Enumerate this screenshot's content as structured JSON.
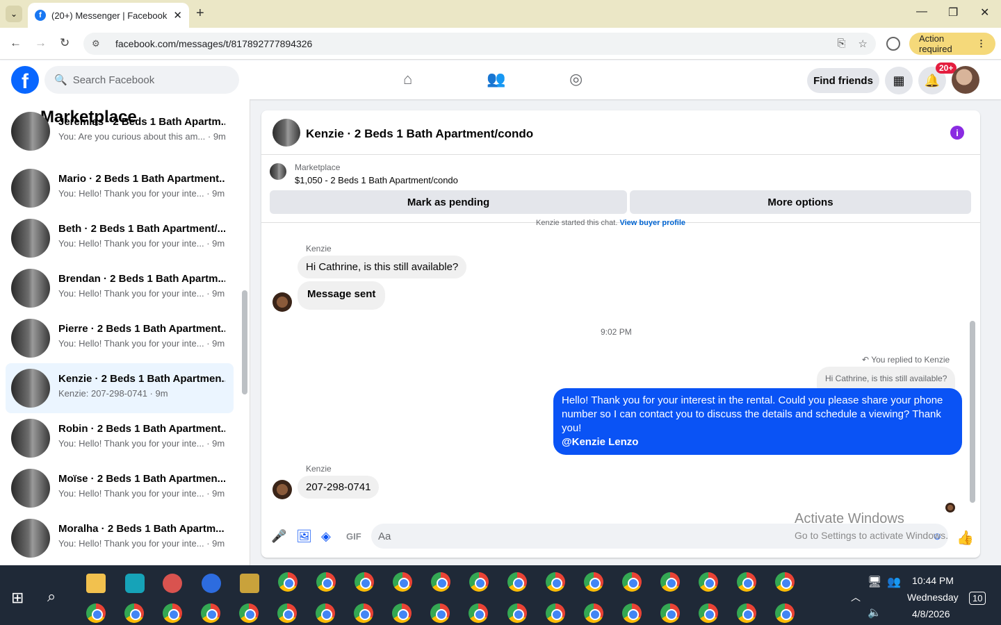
{
  "browser": {
    "tab_title": "(20+) Messenger | Facebook",
    "url": "facebook.com/messages/t/817892777894326",
    "action_required": "Action required",
    "new_tab": "+",
    "close_tab": "✕",
    "minimize": "—",
    "maximize": "❐",
    "close_window": "✕"
  },
  "fb": {
    "search_placeholder": "Search Facebook",
    "find_friends": "Find friends",
    "notif_count": "20+"
  },
  "sidebar": {
    "title": "Marketplace",
    "conversations": [
      {
        "name": "Jeremias · 2 Beds 1 Bath Apartm...",
        "snippet": "You: Are you curious about this am...",
        "time": "9m"
      },
      {
        "name": "Mario · 2 Beds 1 Bath Apartment...",
        "snippet": "You: Hello! Thank you for your inte...",
        "time": "9m"
      },
      {
        "name": "Beth · 2 Beds 1 Bath Apartment/...",
        "snippet": "You: Hello! Thank you for your inte...",
        "time": "9m"
      },
      {
        "name": "Brendan · 2 Beds 1 Bath Apartm...",
        "snippet": "You: Hello! Thank you for your inte...",
        "time": "9m"
      },
      {
        "name": "Pierre · 2 Beds 1 Bath Apartment...",
        "snippet": "You: Hello! Thank you for your inte...",
        "time": "9m"
      },
      {
        "name": "Kenzie · 2 Beds 1 Bath Apartmen...",
        "snippet": "Kenzie: 207-298-0741",
        "time": "9m"
      },
      {
        "name": "Robin · 2 Beds 1 Bath Apartment...",
        "snippet": "You: Hello! Thank you for your inte...",
        "time": "9m"
      },
      {
        "name": "Moïse · 2 Beds 1 Bath Apartmen...",
        "snippet": "You: Hello! Thank you for your inte...",
        "time": "9m"
      },
      {
        "name": "Moralha · 2 Beds 1 Bath Apartm...",
        "snippet": "You: Hello! Thank you for your inte...",
        "time": "9m"
      }
    ]
  },
  "chat": {
    "title": "Kenzie · 2 Beds 1 Bath Apartment/condo",
    "listing_label": "Marketplace",
    "listing_price": "$1,050 - 2 Beds 1 Bath Apartment/condo",
    "mark_pending": "Mark as pending",
    "more_options": "More options",
    "started": "Kenzie started this chat.",
    "view_profile": "View buyer profile",
    "sender1": "Kenzie",
    "msg1": "Hi Cathrine, is this still available?",
    "msg2": "Message sent",
    "time_sep": "9:02 PM",
    "replied_to": "You replied to Kenzie",
    "quoted": "Hi Cathrine, is this still available?",
    "out_msg": "Hello! Thank you for your interest in the rental. Could you please share your phone number so I can contact you to discuss the details and schedule a viewing? Thank you!",
    "mention": "@Kenzie Lenzo",
    "sender2": "Kenzie",
    "msg3": "207-298-0741",
    "composer_placeholder": "Aa"
  },
  "watermark": {
    "line1": "Activate Windows",
    "line2": "Go to Settings to activate Windows."
  },
  "taskbar": {
    "time": "10:44 PM",
    "day": "Wednesday",
    "date": "4/8/2026",
    "notif": "10"
  }
}
